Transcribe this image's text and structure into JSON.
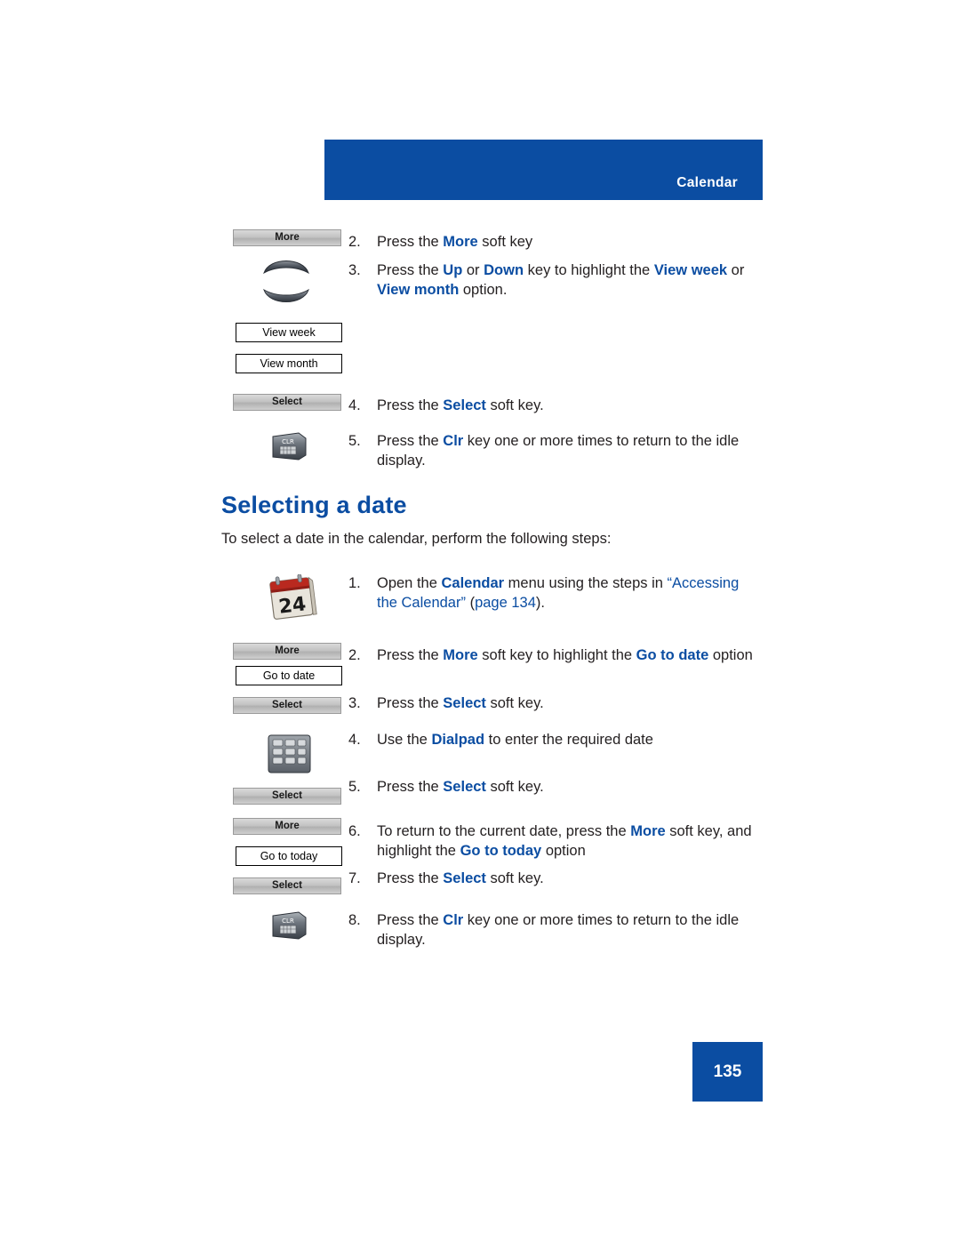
{
  "header": {
    "title": "Calendar"
  },
  "top_steps": [
    {
      "num": "2.",
      "parts": [
        {
          "t": "Press the ",
          "style": "plain"
        },
        {
          "t": "More",
          "style": "blue"
        },
        {
          "t": " soft key",
          "style": "plain"
        }
      ]
    },
    {
      "num": "3.",
      "parts": [
        {
          "t": "Press the ",
          "style": "plain"
        },
        {
          "t": "Up",
          "style": "blue"
        },
        {
          "t": " or ",
          "style": "plain"
        },
        {
          "t": "Down",
          "style": "blue"
        },
        {
          "t": " key to highlight the ",
          "style": "plain"
        },
        {
          "t": "View week",
          "style": "blue"
        },
        {
          "t": " or ",
          "style": "plain"
        },
        {
          "t": "View month",
          "style": "blue"
        },
        {
          "t": " option.",
          "style": "plain"
        }
      ]
    },
    {
      "num": "4.",
      "parts": [
        {
          "t": "Press the ",
          "style": "plain"
        },
        {
          "t": "Select",
          "style": "blue"
        },
        {
          "t": " soft key.",
          "style": "plain"
        }
      ]
    },
    {
      "num": "5.",
      "parts": [
        {
          "t": "Press the ",
          "style": "plain"
        },
        {
          "t": "Clr",
          "style": "blue"
        },
        {
          "t": " key one or more times to return to the idle display.",
          "style": "plain"
        }
      ]
    }
  ],
  "top_graphics": {
    "softkey_more": "More",
    "softkey_select": "Select",
    "menu_view_week": "View week",
    "menu_view_month": "View month",
    "clr_label": "CLR"
  },
  "section": {
    "heading": "Selecting a date",
    "intro": "To select a date in the calendar, perform the following steps:"
  },
  "date_steps": [
    {
      "num": "1.",
      "parts": [
        {
          "t": "Open the ",
          "style": "plain"
        },
        {
          "t": "Calendar",
          "style": "blue"
        },
        {
          "t": " menu using the steps in ",
          "style": "plain"
        },
        {
          "t": "“Accessing the Calendar”",
          "style": "link"
        },
        {
          "t": " (",
          "style": "plain"
        },
        {
          "t": "page 134",
          "style": "link"
        },
        {
          "t": ").",
          "style": "plain"
        }
      ]
    },
    {
      "num": "2.",
      "parts": [
        {
          "t": "Press the ",
          "style": "plain"
        },
        {
          "t": "More",
          "style": "blue"
        },
        {
          "t": " soft key to highlight the ",
          "style": "plain"
        },
        {
          "t": "Go to date",
          "style": "blue"
        },
        {
          "t": " option",
          "style": "plain"
        }
      ]
    },
    {
      "num": "3.",
      "parts": [
        {
          "t": "Press the ",
          "style": "plain"
        },
        {
          "t": "Select",
          "style": "blue"
        },
        {
          "t": " soft key.",
          "style": "plain"
        }
      ]
    },
    {
      "num": "4.",
      "parts": [
        {
          "t": "Use the ",
          "style": "plain"
        },
        {
          "t": "Dialpad",
          "style": "blue"
        },
        {
          "t": " to enter the required date",
          "style": "plain"
        }
      ]
    },
    {
      "num": "5.",
      "parts": [
        {
          "t": "Press the ",
          "style": "plain"
        },
        {
          "t": "Select",
          "style": "blue"
        },
        {
          "t": " soft key.",
          "style": "plain"
        }
      ]
    },
    {
      "num": "6.",
      "parts": [
        {
          "t": "To return to the current date, press the ",
          "style": "plain"
        },
        {
          "t": "More",
          "style": "blue"
        },
        {
          "t": " soft key, and highlight the ",
          "style": "plain"
        },
        {
          "t": "Go to today",
          "style": "blue"
        },
        {
          "t": " option",
          "style": "plain"
        }
      ]
    },
    {
      "num": "7.",
      "parts": [
        {
          "t": "Press the ",
          "style": "plain"
        },
        {
          "t": "Select",
          "style": "blue"
        },
        {
          "t": " soft key.",
          "style": "plain"
        }
      ]
    },
    {
      "num": "8.",
      "parts": [
        {
          "t": "Press the ",
          "style": "plain"
        },
        {
          "t": "Clr",
          "style": "blue"
        },
        {
          "t": " key one or more times to return to the idle display.",
          "style": "plain"
        }
      ]
    }
  ],
  "date_graphics": {
    "calendar_day": "24",
    "softkey_more_1": "More",
    "menu_go_to_date": "Go to date",
    "softkey_select_1": "Select",
    "softkey_select_2": "Select",
    "softkey_more_2": "More",
    "menu_go_to_today": "Go to today",
    "softkey_select_3": "Select",
    "clr_label": "CLR"
  },
  "footer": {
    "page_number": "135"
  },
  "colors": {
    "brand_blue": "#0B4DA2",
    "text": "#231f20"
  }
}
